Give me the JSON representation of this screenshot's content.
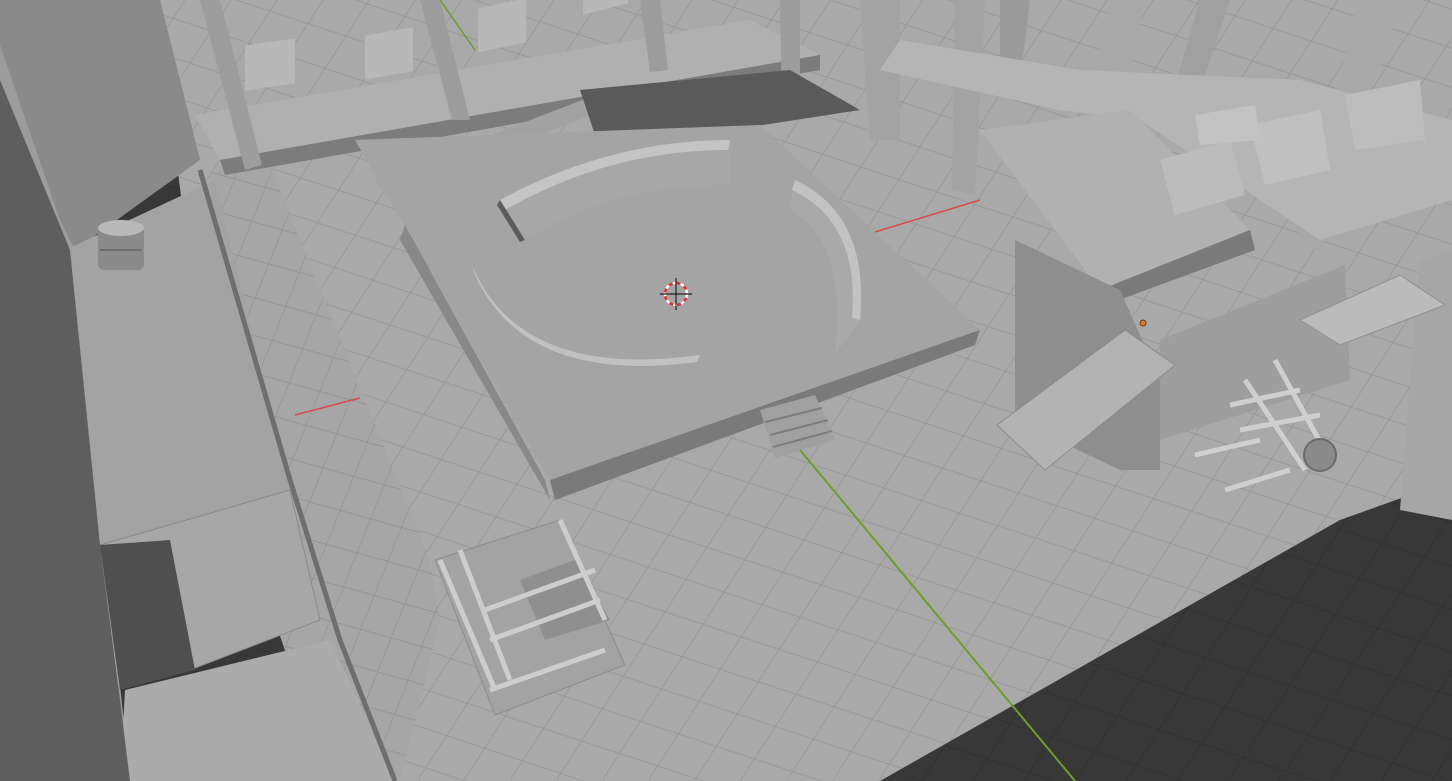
{
  "app": "3D Viewport",
  "viewport": {
    "shading_mode": "solid",
    "view": "perspective",
    "show_grid_floor": true
  },
  "colors": {
    "background": "#3d3d3d",
    "grid_floor": "#353535",
    "grid_line": "#2d2d2d",
    "floor": "#a9a9a9",
    "floor_tile_line": "#8e8e8e",
    "object_light": "#b4b4b4",
    "object_mid": "#9a9a9a",
    "object_dark": "#707070",
    "object_shadow": "#555555",
    "x_axis": "#d84a4a",
    "y_axis": "#6f9d2a",
    "origin_point": "#e8781d",
    "cursor_ring_red": "#e03030",
    "cursor_ring_white": "#ffffff"
  },
  "scene": {
    "objects": [
      "wall-left",
      "conveyor-back",
      "conveyor-right",
      "platform-stage",
      "control-console-back",
      "control-console-right",
      "control-console-front",
      "stairs",
      "ramp",
      "forklift",
      "railing-cart",
      "barrel",
      "boxes",
      "support-pillars"
    ]
  }
}
